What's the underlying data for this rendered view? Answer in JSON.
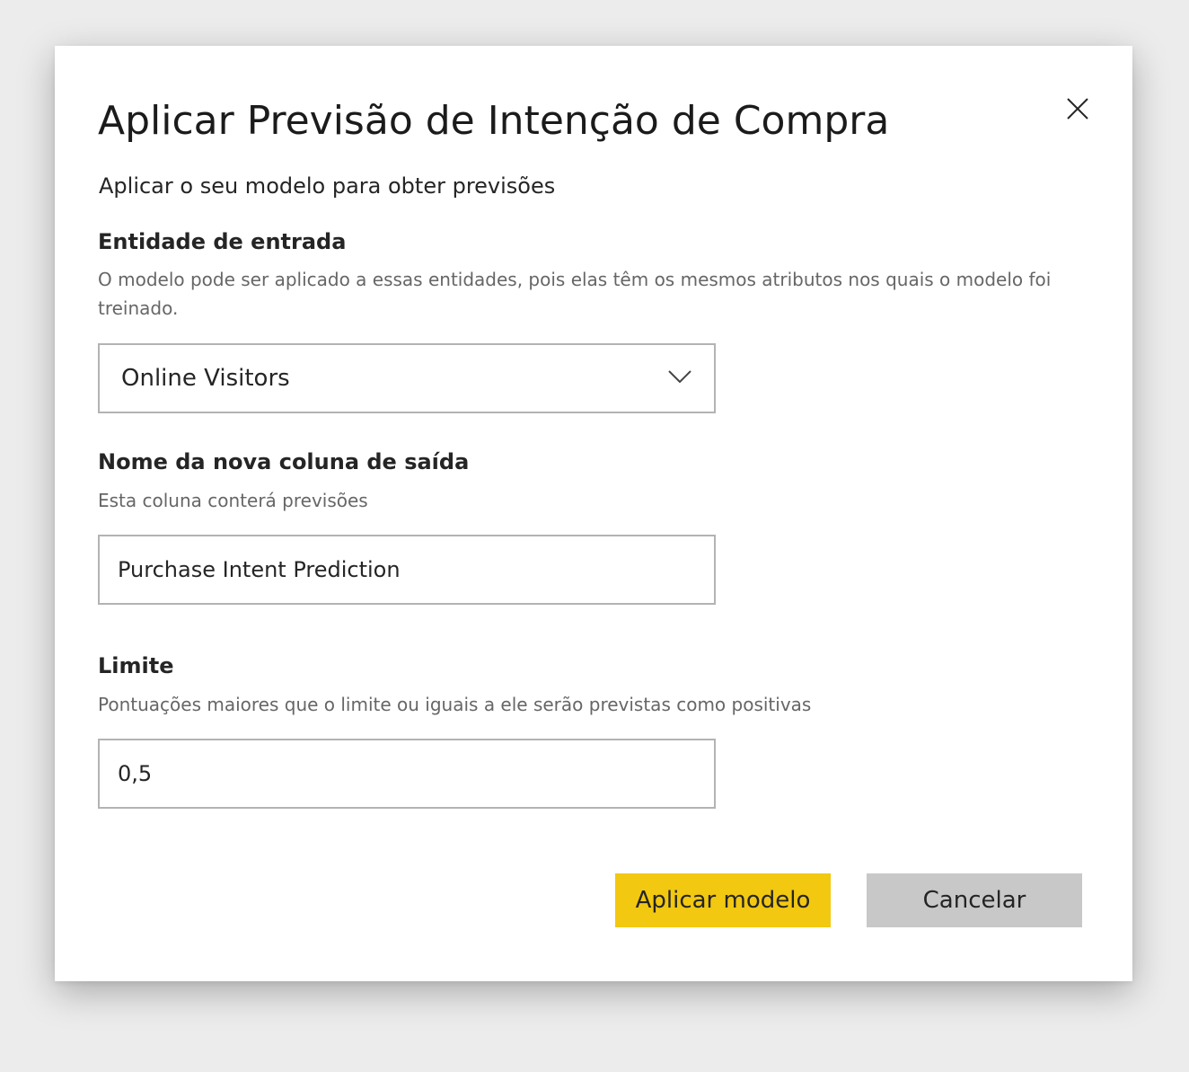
{
  "dialog": {
    "title": "Aplicar Previsão de Intenção de Compra",
    "subtitle": "Aplicar o seu modelo para obter previsões",
    "close_icon": "close-icon"
  },
  "input_entity": {
    "label": "Entidade de entrada",
    "description": "O modelo pode ser aplicado a essas entidades, pois elas têm os mesmos atributos nos quais o modelo foi treinado.",
    "selected_value": "Online Visitors",
    "icon": "chevron-down-icon"
  },
  "output_column": {
    "label": "Nome da nova coluna de saída",
    "description": "Esta coluna conterá previsões",
    "value": "Purchase Intent Prediction"
  },
  "threshold": {
    "label": "Limite",
    "description": "Pontuações maiores que o limite ou iguais a ele serão previstas como positivas",
    "value": "0,5"
  },
  "buttons": {
    "apply_label": "Aplicar modelo",
    "cancel_label": "Cancelar"
  },
  "colors": {
    "primary_button": "#f2c811",
    "secondary_button": "#c8c8c8",
    "border": "#b3b3b3",
    "backdrop": "#ececec"
  }
}
